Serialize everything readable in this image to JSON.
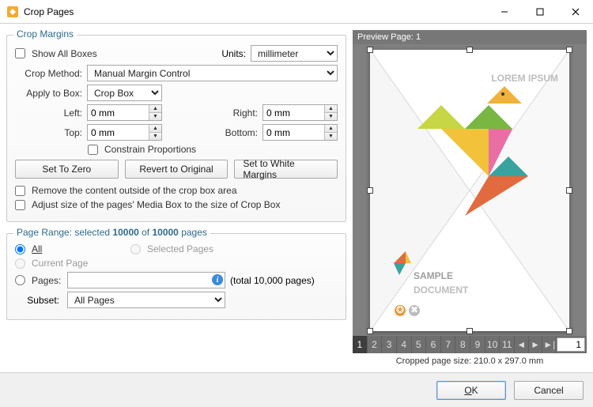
{
  "window": {
    "title": "Crop Pages"
  },
  "crop_margins": {
    "legend": "Crop Margins",
    "show_all_boxes": "Show All Boxes",
    "units_label": "Units:",
    "units_value": "millimeter",
    "crop_method_label": "Crop Method:",
    "crop_method_value": "Manual Margin Control",
    "apply_to_box_label": "Apply to Box:",
    "apply_to_box_value": "Crop Box",
    "left_label": "Left:",
    "left_value": "0 mm",
    "right_label": "Right:",
    "right_value": "0 mm",
    "top_label": "Top:",
    "top_value": "0 mm",
    "bottom_label": "Bottom:",
    "bottom_value": "0 mm",
    "constrain": "Constrain Proportions",
    "btn_zero": "Set To Zero",
    "btn_revert": "Revert to Original",
    "btn_white": "Set to White Margins",
    "remove_outside": "Remove the content outside of the crop box area",
    "adjust_mediabox": "Adjust size of the pages' Media Box to the size of Crop Box"
  },
  "page_range": {
    "legend_prefix": "Page Range: selected ",
    "selected": "10000",
    "mid": " of ",
    "total": "10000",
    "suffix": " pages",
    "all": "All",
    "selected_pages": "Selected Pages",
    "current_page": "Current Page",
    "pages_label": "Pages:",
    "pages_value": "",
    "pages_total": "(total 10,000 pages)",
    "subset_label": "Subset:",
    "subset_value": "All Pages"
  },
  "preview": {
    "header": "Preview Page: 1",
    "pages": [
      "1",
      "2",
      "3",
      "4",
      "5",
      "6",
      "7",
      "8",
      "9",
      "10",
      "11"
    ],
    "current_input": "1",
    "crop_size": "Cropped page size: 210.0 x 297.0 mm",
    "sample_title1": "SAMPLE",
    "sample_title2": "DOCUMENT",
    "lorem": "LOREM IPSUM"
  },
  "buttons": {
    "ok": "OK",
    "cancel": "Cancel"
  }
}
